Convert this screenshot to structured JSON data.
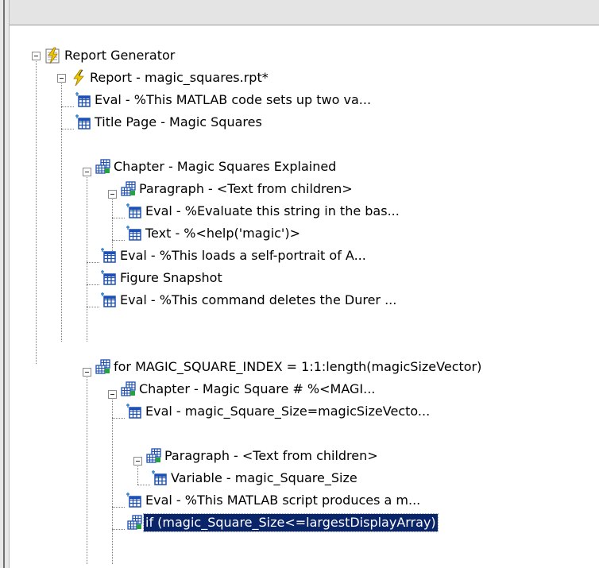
{
  "tree": {
    "nodes": [
      {
        "label": "Report Generator",
        "icon": "report-generator-icon"
      },
      {
        "label": "Report - magic_squares.rpt*",
        "icon": "lightning-icon"
      },
      {
        "label": "Eval - %This MATLAB code sets up two va...",
        "icon": "component-grid-icon"
      },
      {
        "label": "Title Page - Magic Squares",
        "icon": "component-grid-icon"
      },
      {
        "label": "Chapter - Magic Squares Explained",
        "icon": "parent-component-icon"
      },
      {
        "label": "Paragraph - <Text from children>",
        "icon": "parent-component-icon"
      },
      {
        "label": "Eval - %Evaluate this string in the bas...",
        "icon": "component-grid-icon"
      },
      {
        "label": "Text - %<help('magic')>",
        "icon": "component-grid-icon"
      },
      {
        "label": "Eval - %This loads a self-portrait of A...",
        "icon": "component-grid-icon"
      },
      {
        "label": "Figure Snapshot",
        "icon": "component-grid-icon"
      },
      {
        "label": "Eval - %This command deletes the Durer ...",
        "icon": "component-grid-icon"
      },
      {
        "label": "for MAGIC_SQUARE_INDEX = 1:1:length(magicSizeVector)",
        "icon": "parent-component-icon"
      },
      {
        "label": "Chapter - Magic Square # %<MAGI...",
        "icon": "parent-component-icon"
      },
      {
        "label": "Eval - magic_Square_Size=magicSizeVecto...",
        "icon": "component-grid-icon"
      },
      {
        "label": "Paragraph - <Text from children>",
        "icon": "parent-component-icon"
      },
      {
        "label": "Variable - magic_Square_Size",
        "icon": "component-grid-icon"
      },
      {
        "label": "Eval - %This MATLAB script produces a m...",
        "icon": "component-grid-icon"
      },
      {
        "label": "if (magic_Square_Size<=largestDisplayArray)",
        "icon": "parent-component-icon",
        "selected": true
      }
    ]
  },
  "colors": {
    "selection": "#0a246a",
    "grid_icon_blue": "#1e50b4",
    "lightning_yellow": "#f0c800"
  }
}
